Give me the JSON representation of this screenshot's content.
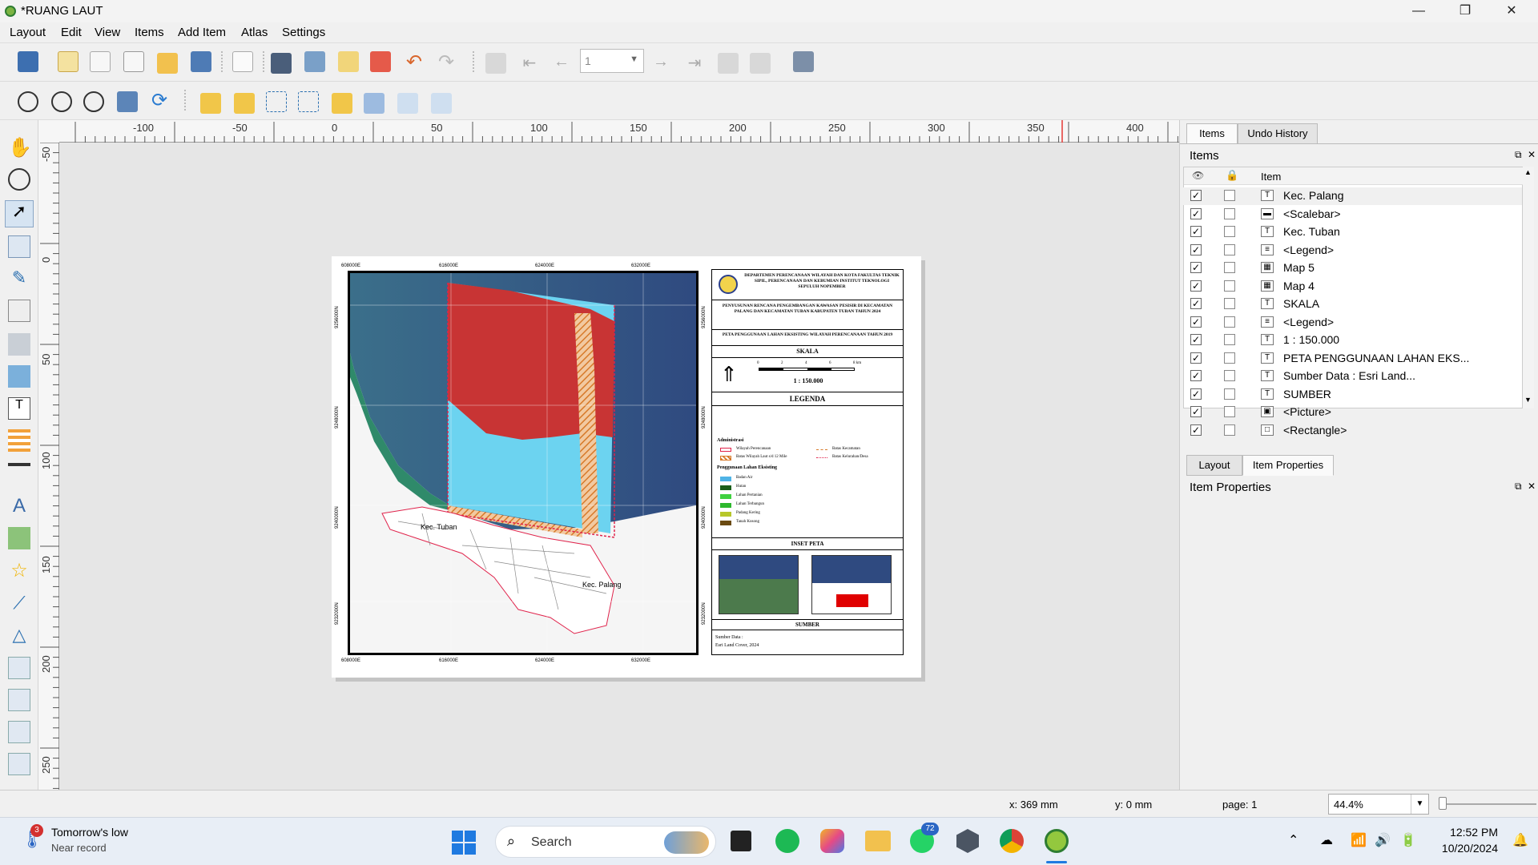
{
  "window": {
    "title": "*RUANG LAUT",
    "min": "—",
    "max": "❐",
    "close": "✕"
  },
  "menu": [
    "Layout",
    "Edit",
    "View",
    "Items",
    "Add Item",
    "Atlas",
    "Settings"
  ],
  "toolbar": {
    "page_number": "1"
  },
  "ruler": {
    "h_labels": [
      "-100",
      "-50",
      "0",
      "50",
      "100",
      "150",
      "200",
      "250",
      "300",
      "350",
      "400"
    ],
    "v_labels": [
      "-50",
      "0",
      "50",
      "100",
      "150",
      "200",
      "250"
    ]
  },
  "map": {
    "coords_top": [
      "608000E",
      "616000E",
      "624000E",
      "632000E"
    ],
    "coords_bottom": [
      "608000E",
      "616000E",
      "624000E",
      "632000E"
    ],
    "coords_left": [
      "9256000N",
      "9248000N",
      "9240000N",
      "9232000N"
    ],
    "coords_right": [
      "9256000N",
      "9248000N",
      "9240000N",
      "9232000N"
    ],
    "label_tuban": "Kec. Tuban",
    "label_palang": "Kec. Palang",
    "title_block": {
      "institution": "DEPARTEMEN PERENCANAAN WILAYAH DAN KOTA FAKULTAS TEKNIK SIPIL, PERENCANAAN DAN KEBUMIAN INSTITUT TEKNOLOGI SEPULUH NOPEMBER",
      "project": "PENYUSUNAN RENCANA PENGEMBANGAN KAWASAN PESISIR DI KECAMATAN PALANG DAN KECAMATAN TUBAN KABUPATEN TUBAN TAHUN 2024",
      "map_title": "PETA PENGGUNAAN LAHAN EKSISTING WILAYAH PERENCANAAN TAHUN 2019",
      "skala_heading": "SKALA",
      "scale_ticks": [
        "0",
        "2",
        "4",
        "6",
        "8 km"
      ],
      "scale_text": "1 : 150.000",
      "legenda_heading": "LEGENDA",
      "admin_heading": "Administrasi",
      "admin_items": [
        "Wilayah Perencanaan",
        "Batas Wilayah Laut s/d 12 Mile"
      ],
      "admin_items_right": [
        "Batas Kecamatan",
        "Batas Kelurahan/Desa"
      ],
      "landuse_heading": "Penggunaan Lahan Eksisting",
      "landuse": [
        {
          "label": "Badan Air",
          "color": "#4fb3e6"
        },
        {
          "label": "Hutan",
          "color": "#1a5e1a"
        },
        {
          "label": "Lahan Pertanian",
          "color": "#3fd13f"
        },
        {
          "label": "Lahan Terbangun",
          "color": "#2db82d"
        },
        {
          "label": "Padang Kering",
          "color": "#b7c72a"
        },
        {
          "label": "Tanah Kosong",
          "color": "#6b4b12"
        }
      ],
      "inset_heading": "INSET PETA",
      "sumber_heading": "SUMBER",
      "sumber_text_1": "Sumber Data :",
      "sumber_text_2": "Esri Land Cover, 2024"
    }
  },
  "panel": {
    "tabs_top": [
      "Items",
      "Undo History"
    ],
    "items_title": "Items",
    "item_col": "Item",
    "items": [
      {
        "label": "Kec. Palang",
        "icon": "T"
      },
      {
        "label": "<Scalebar>",
        "icon": "▬"
      },
      {
        "label": "Kec. Tuban",
        "icon": "T"
      },
      {
        "label": "<Legend>",
        "icon": "≡"
      },
      {
        "label": "Map 5",
        "icon": "▦"
      },
      {
        "label": "Map 4",
        "icon": "▦"
      },
      {
        "label": "SKALA",
        "icon": "T"
      },
      {
        "label": "<Legend>",
        "icon": "≡"
      },
      {
        "label": "1 : 150.000",
        "icon": "T"
      },
      {
        "label": "PETA PENGGUNAAN LAHAN EKS...",
        "icon": "T"
      },
      {
        "label": "Sumber Data : Esri Land...",
        "icon": "T"
      },
      {
        "label": "SUMBER",
        "icon": "T"
      },
      {
        "label": "<Picture>",
        "icon": "▣"
      },
      {
        "label": "<Rectangle>",
        "icon": "□"
      },
      {
        "label": "<Rectangle>",
        "icon": "□"
      }
    ],
    "tabs_bottom": [
      "Layout",
      "Item Properties"
    ],
    "props_title": "Item Properties"
  },
  "status": {
    "x": "x: 369 mm",
    "y": "y: 0 mm",
    "page": "page: 1",
    "zoom": "44.4%"
  },
  "taskbar": {
    "weather_title": "Tomorrow's low",
    "weather_sub": "Near record",
    "weather_badge": "3",
    "search": "Search",
    "whatsapp_badge": "72",
    "time": "12:52 PM",
    "date": "10/20/2024"
  }
}
